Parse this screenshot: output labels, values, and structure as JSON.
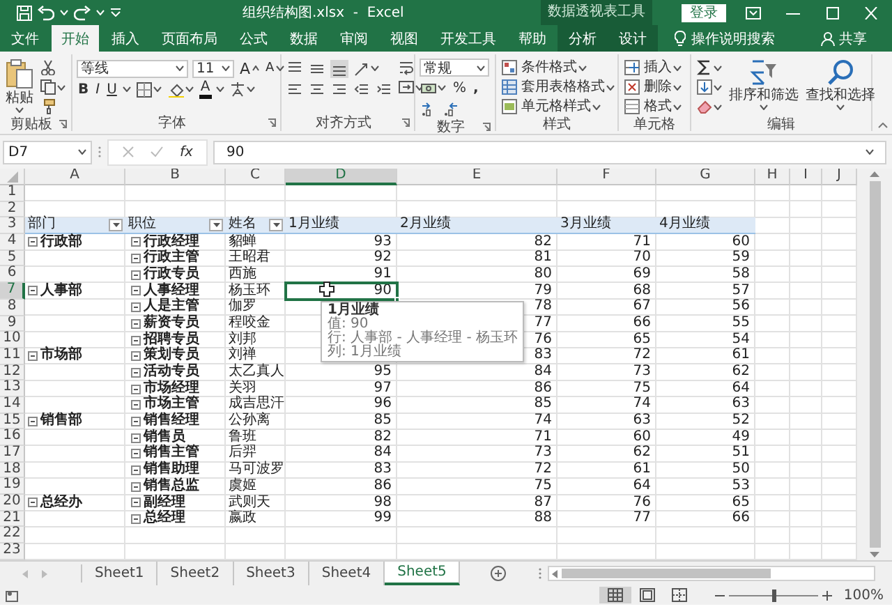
{
  "title_bar": {
    "title": "组织结构图.xlsx  -  Excel",
    "context_label": "数据透视表工具",
    "sign_in": "登录"
  },
  "tabs": [
    {
      "label": "文件",
      "kind": "file",
      "selected": false
    },
    {
      "label": "开始",
      "kind": "main",
      "selected": true
    },
    {
      "label": "插入",
      "kind": "main",
      "selected": false
    },
    {
      "label": "页面布局",
      "kind": "main",
      "selected": false
    },
    {
      "label": "公式",
      "kind": "main",
      "selected": false
    },
    {
      "label": "数据",
      "kind": "main",
      "selected": false
    },
    {
      "label": "审阅",
      "kind": "main",
      "selected": false
    },
    {
      "label": "视图",
      "kind": "main",
      "selected": false
    },
    {
      "label": "开发工具",
      "kind": "main",
      "selected": false
    },
    {
      "label": "帮助",
      "kind": "main",
      "selected": false
    },
    {
      "label": "分析",
      "kind": "context",
      "selected": false
    },
    {
      "label": "设计",
      "kind": "context",
      "selected": false
    }
  ],
  "tell_me": "操作说明搜索",
  "share": "共享",
  "ribbon": {
    "clipboard": {
      "paste": "粘贴",
      "label": "剪贴板"
    },
    "font": {
      "font_name": "等线",
      "font_size": "11",
      "grow": "A",
      "shrink": "A",
      "bold": "B",
      "italic": "I",
      "underline": "U",
      "font_color": "A",
      "label": "字体"
    },
    "alignment": {
      "label": "对齐方式"
    },
    "number": {
      "format": "常规",
      "percent": "%",
      "comma": ",",
      "label": "数字"
    },
    "styles": {
      "items": [
        "条件格式",
        "套用表格格式",
        "单元格样式"
      ],
      "label": "样式"
    },
    "cells": {
      "items": [
        "插入",
        "删除",
        "格式"
      ],
      "label": "单元格"
    },
    "editing": {
      "sort": "排序和筛选",
      "find": "查找和选择",
      "label": "编辑"
    }
  },
  "formula_bar": {
    "name_box": "D7",
    "function_button": "fx",
    "formula": "90"
  },
  "columns": [
    {
      "label": "A",
      "selected": false
    },
    {
      "label": "B",
      "selected": false
    },
    {
      "label": "C",
      "selected": false
    },
    {
      "label": "D",
      "selected": true
    },
    {
      "label": "E",
      "selected": false
    },
    {
      "label": "F",
      "selected": false
    },
    {
      "label": "G",
      "selected": false
    },
    {
      "label": "H",
      "selected": false
    },
    {
      "label": "I",
      "selected": false
    },
    {
      "label": "J",
      "selected": false
    }
  ],
  "row_numbers": [
    {
      "label": "1",
      "selected": false
    },
    {
      "label": "2",
      "selected": false
    },
    {
      "label": "3",
      "selected": false
    },
    {
      "label": "4",
      "selected": false
    },
    {
      "label": "5",
      "selected": false
    },
    {
      "label": "6",
      "selected": false
    },
    {
      "label": "7",
      "selected": true
    },
    {
      "label": "8",
      "selected": false
    },
    {
      "label": "9",
      "selected": false
    },
    {
      "label": "10",
      "selected": false
    },
    {
      "label": "11",
      "selected": false
    },
    {
      "label": "12",
      "selected": false
    },
    {
      "label": "13",
      "selected": false
    },
    {
      "label": "14",
      "selected": false
    },
    {
      "label": "15",
      "selected": false
    },
    {
      "label": "16",
      "selected": false
    },
    {
      "label": "17",
      "selected": false
    },
    {
      "label": "18",
      "selected": false
    },
    {
      "label": "19",
      "selected": false
    },
    {
      "label": "20",
      "selected": false
    },
    {
      "label": "21",
      "selected": false
    },
    {
      "label": "22",
      "selected": false
    },
    {
      "label": "23",
      "selected": false
    }
  ],
  "pivot": {
    "headers": [
      {
        "label": "部门",
        "filter": true
      },
      {
        "label": "职位",
        "filter": true
      },
      {
        "label": "姓名",
        "filter": true
      },
      {
        "label": "1月业绩",
        "filter": false
      },
      {
        "label": "2月业绩",
        "filter": false
      },
      {
        "label": "3月业绩",
        "filter": false
      },
      {
        "label": "4月业绩",
        "filter": false
      }
    ],
    "groups": [
      {
        "department": "行政部",
        "expanded": true,
        "rows": [
          {
            "position": "行政经理",
            "expanded": true,
            "name": "貂蝉",
            "m1": "93",
            "m2": "82",
            "m3": "71",
            "m4": "60"
          },
          {
            "position": "行政主管",
            "expanded": true,
            "name": "王昭君",
            "m1": "92",
            "m2": "81",
            "m3": "70",
            "m4": "59"
          },
          {
            "position": "行政专员",
            "expanded": true,
            "name": "西施",
            "m1": "91",
            "m2": "80",
            "m3": "69",
            "m4": "58"
          }
        ]
      },
      {
        "department": "人事部",
        "expanded": true,
        "rows": [
          {
            "position": "人事经理",
            "expanded": true,
            "name": "杨玉环",
            "m1": "90",
            "m2": "79",
            "m3": "68",
            "m4": "57"
          },
          {
            "position": "人是主管",
            "expanded": true,
            "name": "伽罗",
            "m2": "78",
            "m3": "67",
            "m4": "56"
          },
          {
            "position": "薪资专员",
            "expanded": true,
            "name": "程咬金",
            "m2": "77",
            "m3": "66",
            "m4": "55"
          },
          {
            "position": "招聘专员",
            "expanded": true,
            "name": "刘邦",
            "m2": "76",
            "m3": "65",
            "m4": "54"
          }
        ]
      },
      {
        "department": "市场部",
        "expanded": true,
        "rows": [
          {
            "position": "策划专员",
            "expanded": true,
            "name": "刘禅",
            "m2": "83",
            "m3": "72",
            "m4": "61"
          },
          {
            "position": "活动专员",
            "expanded": true,
            "name": "太乙真人",
            "m1": "95",
            "m2": "84",
            "m3": "73",
            "m4": "62"
          },
          {
            "position": "市场经理",
            "expanded": true,
            "name": "关羽",
            "m1": "97",
            "m2": "86",
            "m3": "75",
            "m4": "64"
          },
          {
            "position": "市场主管",
            "expanded": true,
            "name": "成吉思汗",
            "m1": "96",
            "m2": "85",
            "m3": "74",
            "m4": "63"
          }
        ]
      },
      {
        "department": "销售部",
        "expanded": true,
        "rows": [
          {
            "position": "销售经理",
            "expanded": true,
            "name": "公孙离",
            "m1": "85",
            "m2": "74",
            "m3": "63",
            "m4": "52"
          },
          {
            "position": "销售员",
            "expanded": true,
            "name": "鲁班",
            "m1": "82",
            "m2": "71",
            "m3": "60",
            "m4": "49"
          },
          {
            "position": "销售主管",
            "expanded": true,
            "name": "后羿",
            "m1": "84",
            "m2": "73",
            "m3": "62",
            "m4": "51"
          },
          {
            "position": "销售助理",
            "expanded": true,
            "name": "马可波罗",
            "m1": "83",
            "m2": "72",
            "m3": "61",
            "m4": "50"
          },
          {
            "position": "销售总监",
            "expanded": true,
            "name": "虞姬",
            "m1": "86",
            "m2": "75",
            "m3": "64",
            "m4": "53"
          }
        ]
      },
      {
        "department": "总经办",
        "expanded": true,
        "rows": [
          {
            "position": "副经理",
            "expanded": true,
            "name": "武则天",
            "m1": "98",
            "m2": "87",
            "m3": "76",
            "m4": "65"
          },
          {
            "position": "总经理",
            "expanded": true,
            "name": "嬴政",
            "m1": "99",
            "m2": "88",
            "m3": "77",
            "m4": "66"
          }
        ]
      }
    ]
  },
  "tooltip": {
    "title": "1月业绩",
    "lines": [
      "值: 90",
      "行: 人事部 - 人事经理 - 杨玉环",
      "列: 1月业绩"
    ]
  },
  "sheet_tabs": [
    {
      "label": "Sheet1",
      "selected": false
    },
    {
      "label": "Sheet2",
      "selected": false
    },
    {
      "label": "Sheet3",
      "selected": false
    },
    {
      "label": "Sheet4",
      "selected": false
    },
    {
      "label": "Sheet5",
      "selected": true
    }
  ],
  "status_bar": {
    "views": [
      {
        "kind": "normal",
        "selected": true
      },
      {
        "kind": "page_layout",
        "selected": false
      },
      {
        "kind": "page_break",
        "selected": false
      }
    ],
    "zoom": {
      "level": 0.5,
      "reading": "100%"
    }
  }
}
